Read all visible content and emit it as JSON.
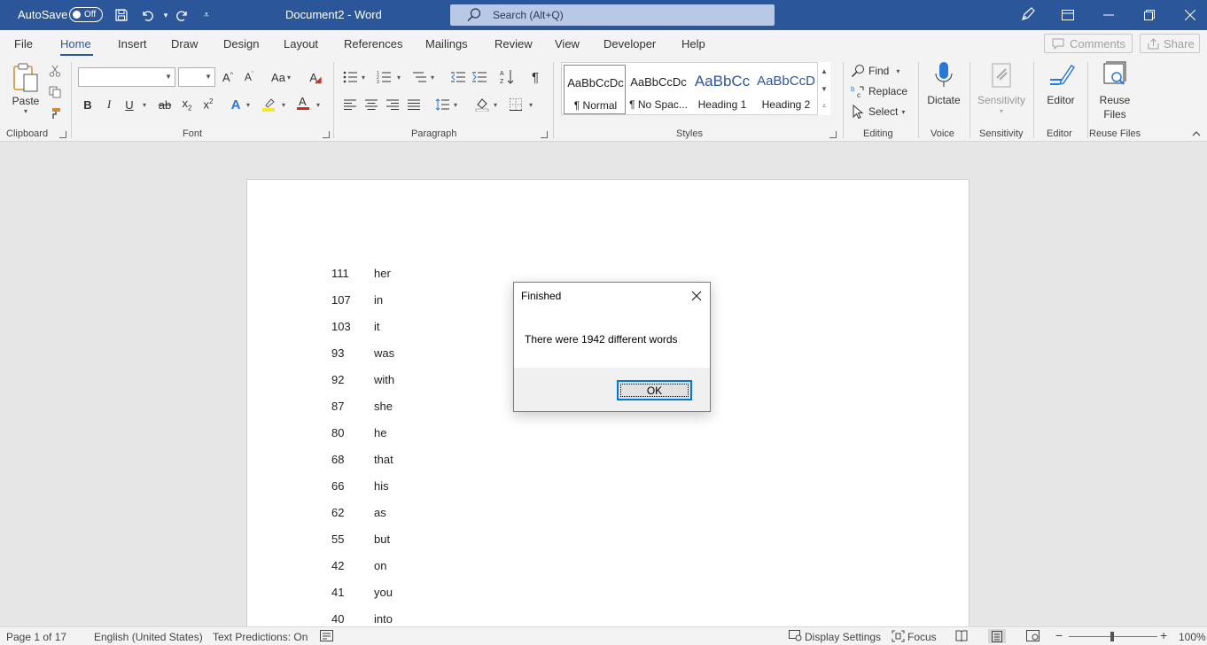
{
  "titlebar": {
    "autosave_label": "AutoSave",
    "autosave_state": "Off",
    "doc_title": "Document2  -  Word",
    "search_placeholder": "Search (Alt+Q)",
    "accent": "#2b579a"
  },
  "tabs": [
    "File",
    "Home",
    "Insert",
    "Draw",
    "Design",
    "Layout",
    "References",
    "Mailings",
    "Review",
    "View",
    "Developer",
    "Help"
  ],
  "active_tab": "Home",
  "top_buttons": {
    "comments": "Comments",
    "share": "Share"
  },
  "ribbon": {
    "clipboard": {
      "paste": "Paste",
      "label": "Clipboard"
    },
    "font": {
      "label": "Font",
      "change_case": "Aa"
    },
    "paragraph": {
      "label": "Paragraph"
    },
    "styles": {
      "label": "Styles",
      "items": [
        {
          "sample": "AaBbCcDc",
          "name": "¶ Normal"
        },
        {
          "sample": "AaBbCcDc",
          "name": "¶ No Spac..."
        },
        {
          "sample": "AaBbCc",
          "name": "Heading 1"
        },
        {
          "sample": "AaBbCcD",
          "name": "Heading 2"
        }
      ]
    },
    "editing": {
      "label": "Editing",
      "find": "Find",
      "replace": "Replace",
      "select": "Select"
    },
    "voice": {
      "label": "Voice",
      "dictate": "Dictate"
    },
    "sensitivity": {
      "label": "Sensitivity",
      "button": "Sensitivity"
    },
    "editor": {
      "label": "Editor",
      "button": "Editor"
    },
    "reuse": {
      "label": "Reuse Files",
      "button_line1": "Reuse",
      "button_line2": "Files"
    }
  },
  "document": {
    "rows": [
      {
        "count": "111",
        "word": "her"
      },
      {
        "count": "107",
        "word": "in"
      },
      {
        "count": "103",
        "word": "it"
      },
      {
        "count": "93",
        "word": "was"
      },
      {
        "count": "92",
        "word": "with"
      },
      {
        "count": "87",
        "word": "she"
      },
      {
        "count": "80",
        "word": "he"
      },
      {
        "count": "68",
        "word": "that"
      },
      {
        "count": "66",
        "word": "his"
      },
      {
        "count": "62",
        "word": "as"
      },
      {
        "count": "55",
        "word": "but"
      },
      {
        "count": "42",
        "word": "on"
      },
      {
        "count": "41",
        "word": "you"
      },
      {
        "count": "40",
        "word": "into"
      }
    ]
  },
  "dialog": {
    "title": "Finished",
    "message": "There were 1942 different words",
    "ok": "OK"
  },
  "statusbar": {
    "page": "Page 1 of 17",
    "language": "English (United States)",
    "predictions": "Text Predictions: On",
    "display_settings": "Display Settings",
    "focus": "Focus",
    "zoom": "100%"
  }
}
